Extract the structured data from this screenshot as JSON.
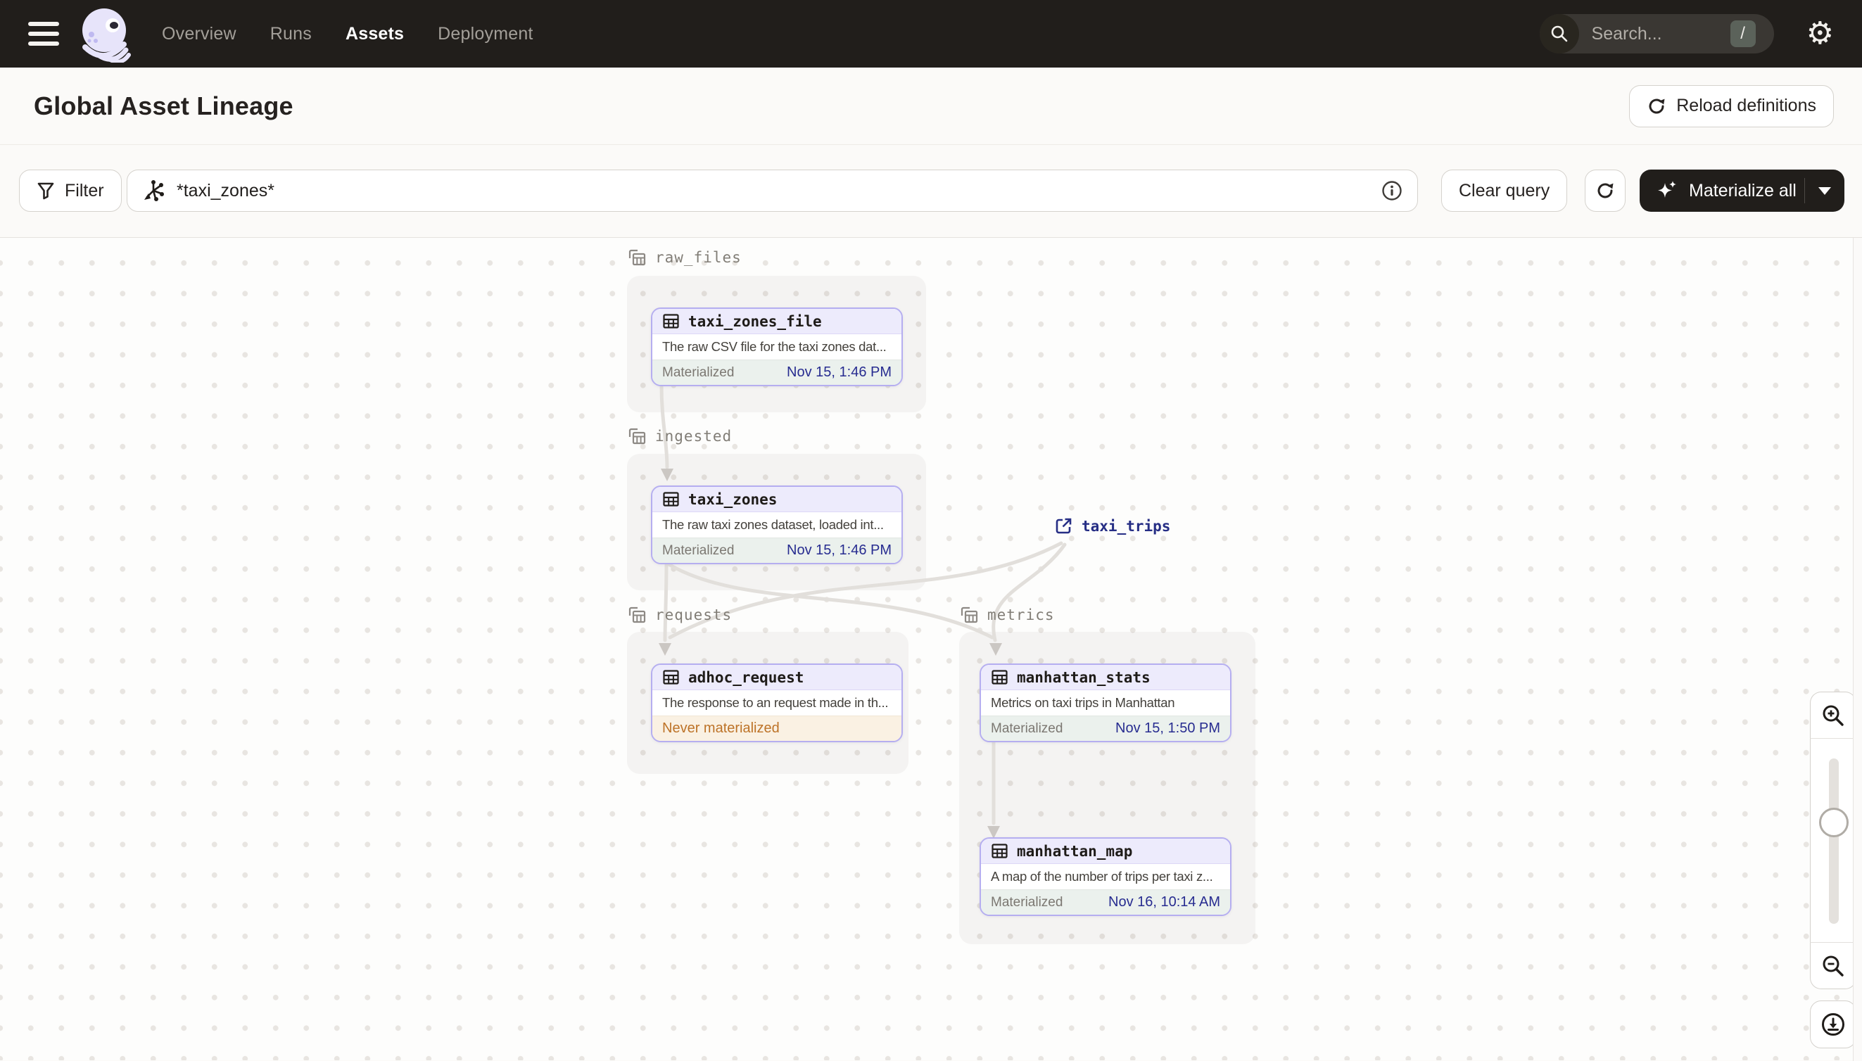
{
  "nav": {
    "items": [
      {
        "label": "Overview"
      },
      {
        "label": "Runs"
      },
      {
        "label": "Assets"
      },
      {
        "label": "Deployment"
      }
    ],
    "search_placeholder": "Search...",
    "search_shortcut": "/"
  },
  "header": {
    "title": "Global Asset Lineage",
    "reload_button": "Reload definitions"
  },
  "toolbar": {
    "filter_button": "Filter",
    "query_value": "*taxi_zones*",
    "clear_button": "Clear query",
    "materialize_button": "Materialize all"
  },
  "graph": {
    "groups": [
      {
        "name": "raw_files"
      },
      {
        "name": "ingested"
      },
      {
        "name": "requests"
      },
      {
        "name": "metrics"
      }
    ],
    "nodes": [
      {
        "name": "taxi_zones_file",
        "description": "The raw CSV file for the taxi zones dat...",
        "status": "Materialized",
        "timestamp": "Nov 15, 1:46 PM"
      },
      {
        "name": "taxi_zones",
        "description": "The raw taxi zones dataset, loaded int...",
        "status": "Materialized",
        "timestamp": "Nov 15, 1:46 PM"
      },
      {
        "name": "adhoc_request",
        "description": "The response to an request made in th...",
        "status": "Never materialized",
        "timestamp": ""
      },
      {
        "name": "manhattan_stats",
        "description": "Metrics on taxi trips in Manhattan",
        "status": "Materialized",
        "timestamp": "Nov 15, 1:50 PM"
      },
      {
        "name": "manhattan_map",
        "description": "A map of the number of trips per taxi z...",
        "status": "Materialized",
        "timestamp": "Nov 16, 10:14 AM"
      }
    ],
    "external_asset": {
      "name": "taxi_trips"
    }
  },
  "colors": {
    "nav_bg": "#211e1b",
    "accent_border": "#b5aef0",
    "node_header_bg": "#edebfc",
    "materialized_bg": "#ebf1ed",
    "never_materialized_bg": "#faf1e3",
    "never_materialized_text": "#bd7328",
    "timestamp_text": "#272c90",
    "external_link_text": "#262e85"
  }
}
